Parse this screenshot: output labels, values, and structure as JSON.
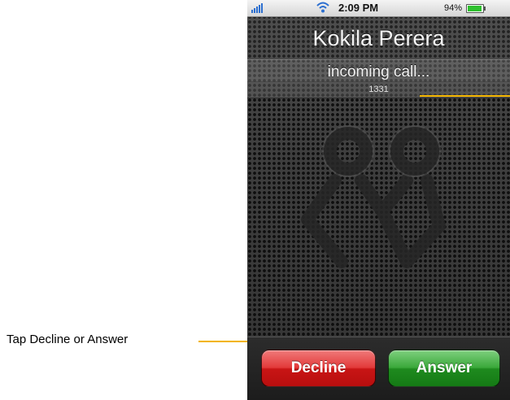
{
  "status_bar": {
    "time": "2:09 PM",
    "battery": "94%",
    "battery_level": 0.94,
    "icons": [
      "signal-bars-icon",
      "wifi-icon",
      "battery-icon"
    ]
  },
  "call": {
    "caller_name": "Kokila Perera",
    "status": "incoming call...",
    "number": "1331"
  },
  "logo": {
    "icon": "people-logo-icon"
  },
  "buttons": {
    "decline_label": "Decline",
    "answer_label": "Answer",
    "decline_color": "#d52525",
    "answer_color": "#2a9a2a"
  },
  "annotation": {
    "label": "Tap Decline or Answer",
    "line_color": "#f2b400"
  }
}
